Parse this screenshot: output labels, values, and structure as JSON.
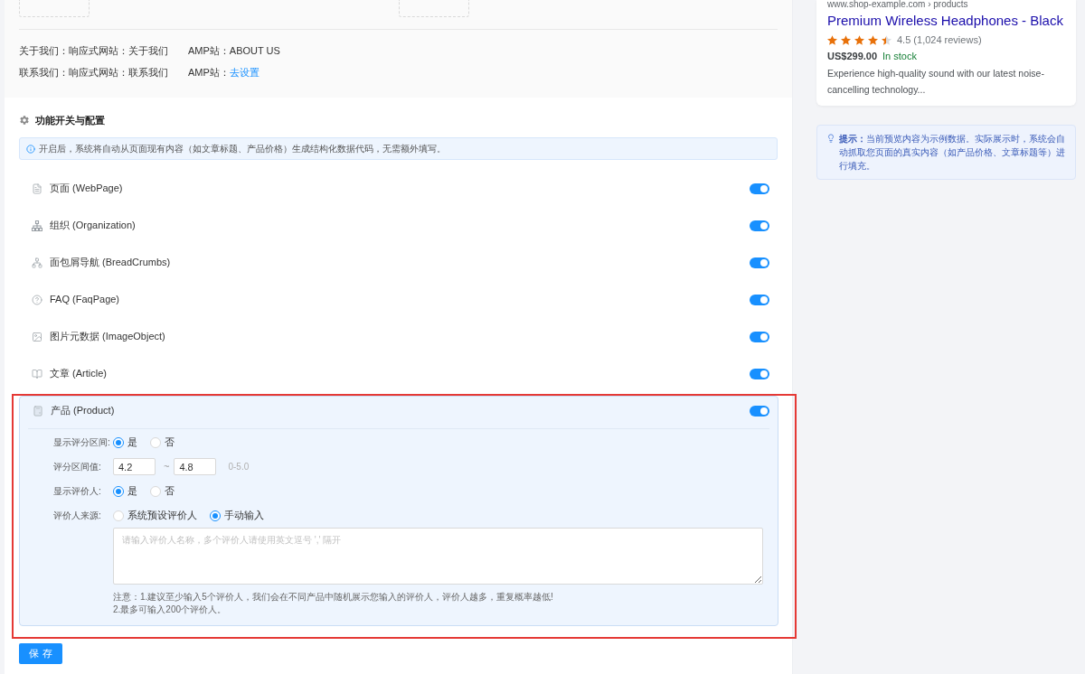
{
  "page_links": [
    {
      "label": "关于我们：响应式网站：关于我们",
      "amp_label": "AMP站：",
      "amp_value": "ABOUT US",
      "kind": "text"
    },
    {
      "label": "联系我们：响应式网站：联系我们",
      "amp_label": "AMP站：",
      "amp_value": "去设置",
      "kind": "link"
    }
  ],
  "section": {
    "title": "功能开关与配置",
    "info": "开启后，系统将自动从页面现有内容（如文章标题、产品价格）生成结构化数据代码，无需额外填写。"
  },
  "schema_items": [
    {
      "label": "页面 (WebPage)",
      "on": true,
      "expanded": false,
      "highlighted": false
    },
    {
      "label": "组织 (Organization)",
      "on": true,
      "expanded": false,
      "highlighted": false
    },
    {
      "label": "面包屑导航 (BreadCrumbs)",
      "on": true,
      "expanded": false,
      "highlighted": false
    },
    {
      "label": "FAQ (FaqPage)",
      "on": true,
      "expanded": false,
      "highlighted": false
    },
    {
      "label": "图片元数据 (ImageObject)",
      "on": true,
      "expanded": false,
      "highlighted": false
    },
    {
      "label": "文章 (Article)",
      "on": true,
      "expanded": false,
      "highlighted": false
    },
    {
      "label": "产品 (Product)",
      "on": true,
      "expanded": true,
      "highlighted": true,
      "config": {
        "fields": [
          {
            "kind": "radio",
            "label": "显示评分区间:",
            "options": [
              {
                "label": "是",
                "selected": true
              },
              {
                "label": "否",
                "selected": false
              }
            ]
          },
          {
            "kind": "range",
            "label": "评分区间值:",
            "inputs": [
              {
                "value": "4.2"
              },
              {
                "value": "4.8"
              }
            ],
            "separator": "~",
            "hint": "0-5.0"
          },
          {
            "kind": "radio",
            "label": "显示评价人:",
            "options": [
              {
                "label": "是",
                "selected": true
              },
              {
                "label": "否",
                "selected": false
              }
            ]
          },
          {
            "kind": "radio",
            "label": "评价人来源:",
            "options": [
              {
                "label": "系统预设评价人",
                "selected": false
              },
              {
                "label": "手动输入",
                "selected": true
              }
            ]
          }
        ],
        "textarea": {
          "placeholder": "请输入评价人名称，多个评价人请使用英文逗号 ',' 隔开"
        },
        "notes": [
          "注意：1.建议至少输入5个评价人，我们会在不同产品中随机展示您输入的评价人，评价人越多，重复概率越低!",
          "2.最多可输入200个评价人。"
        ]
      }
    }
  ],
  "save_button": {
    "label": "保 存"
  },
  "preview": {
    "url": "www.shop-example.com › products",
    "title": "Premium Wireless Headphones - Black",
    "stars": 4.5,
    "rating": "4.5 (1,024 reviews)",
    "price": "US$299.00",
    "availability": "In stock",
    "description": "Experience high-quality sound with our latest noise-cancelling technology..."
  },
  "tip": "**提示：**当前预览内容为示例数据。实际展示时，系统会自动抓取您页面的真实内容（如产品价格、文章标题等）进行填充。"
}
